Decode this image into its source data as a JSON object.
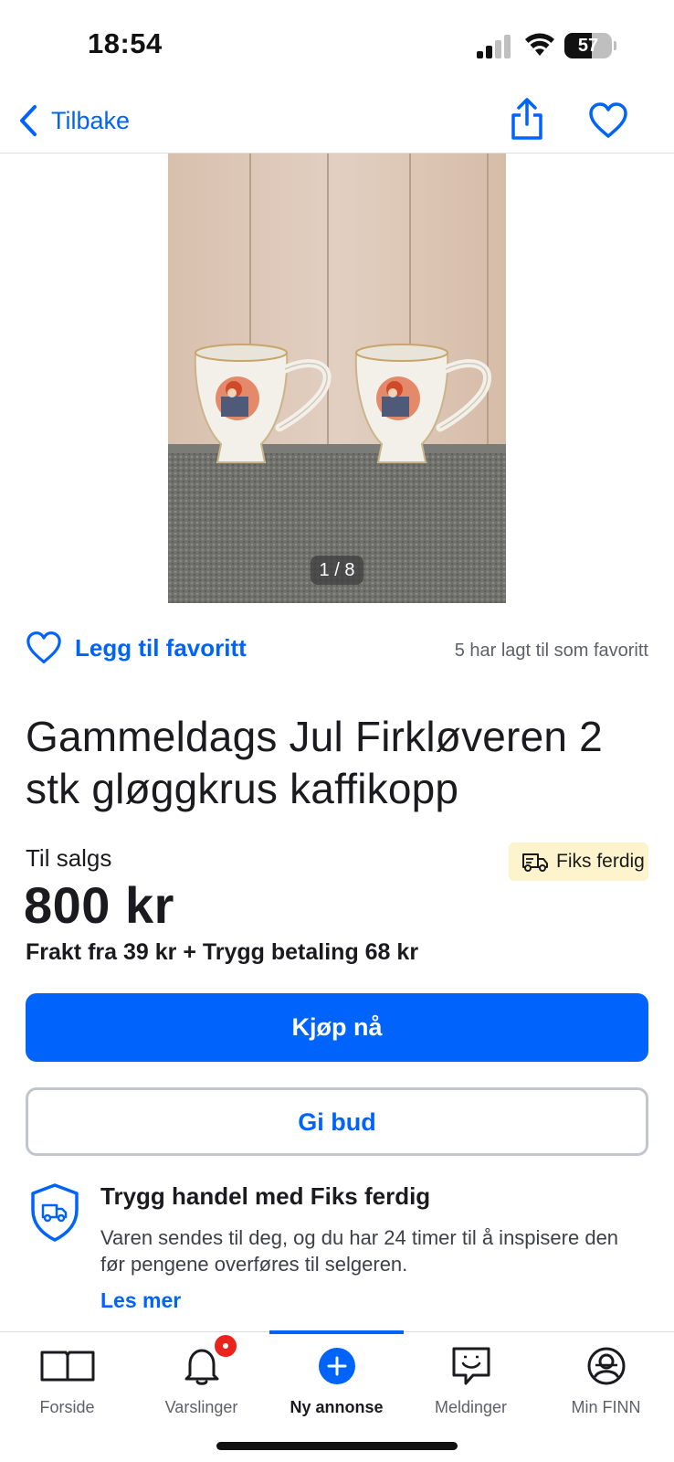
{
  "status_bar": {
    "time": "18:54",
    "battery": "57",
    "battery_level_percent": 57
  },
  "nav": {
    "back_label": "Tilbake",
    "icons": [
      "chevron-left-icon",
      "share-icon",
      "heart-icon"
    ]
  },
  "gallery": {
    "counter": "1 / 8",
    "current_image": 1,
    "total_images": 8
  },
  "favorite": {
    "label": "Legg til favoritt",
    "count_text": "5 har lagt til som favoritt"
  },
  "listing": {
    "title": "Gammeldags Jul Firkløveren 2 stk gløggkrus kaffikopp",
    "sale_label": "Til salgs",
    "badge": "Fiks ferdig",
    "price": "800 kr",
    "shipping": "Frakt fra 39 kr + Trygg betaling 68 kr"
  },
  "actions": {
    "buy": "Kjøp nå",
    "bid": "Gi bud"
  },
  "info": {
    "title": "Trygg handel med Fiks ferdig",
    "text": "Varen sendes til deg, og du har 24 timer til å inspisere den før pengene overføres til selgeren.",
    "read_more": "Les mer"
  },
  "tabbar": {
    "items": [
      {
        "label": "Forside",
        "icon": "book-icon"
      },
      {
        "label": "Varslinger",
        "icon": "bell-icon"
      },
      {
        "label": "Ny annonse",
        "icon": "plus-circle-icon"
      },
      {
        "label": "Meldinger",
        "icon": "chat-icon"
      },
      {
        "label": "Min FINN",
        "icon": "profile-icon"
      }
    ],
    "active": "Ny annonse"
  },
  "colors": {
    "accent": "#0063fb",
    "badge_bg": "#fdf4cd",
    "notification": "#e8241c",
    "text": "#1b1b1f"
  }
}
